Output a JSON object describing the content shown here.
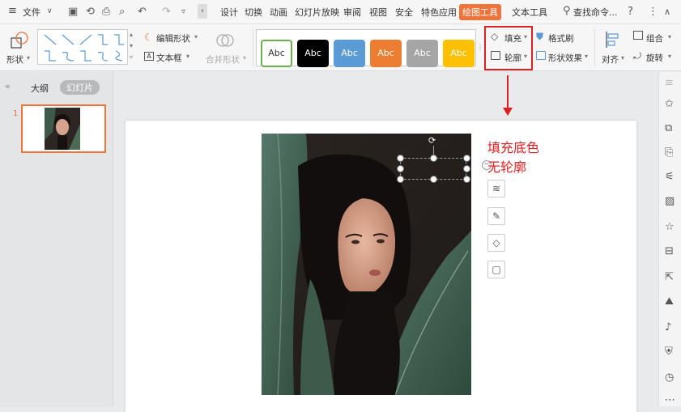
{
  "menubar": {
    "file_label": "文件",
    "tabs": [
      "设计",
      "切换",
      "动画",
      "幻灯片放映",
      "审阅",
      "视图",
      "安全",
      "特色应用",
      "绘图工具",
      "文本工具"
    ],
    "active_tab": "绘图工具",
    "search_label": "查找命令...",
    "accent_color": "#f0733a"
  },
  "ribbon": {
    "shape_label": "形状",
    "edit_shape_label": "编辑形状",
    "textbox_label": "文本框",
    "merge_shape_label": "合并形状",
    "style_swatches": [
      {
        "label": "Abc",
        "bg": "#ffffff",
        "border": "#6ab04c",
        "fg": "#333333"
      },
      {
        "label": "Abc",
        "bg": "#000000",
        "border": "#000000",
        "fg": "#ffffff"
      },
      {
        "label": "Abc",
        "bg": "#5b9bd5",
        "border": "#5b9bd5",
        "fg": "#ffffff"
      },
      {
        "label": "Abc",
        "bg": "#ed7d31",
        "border": "#ed7d31",
        "fg": "#ffffff"
      },
      {
        "label": "Abc",
        "bg": "#a5a5a5",
        "border": "#a5a5a5",
        "fg": "#ffffff"
      },
      {
        "label": "Abc",
        "bg": "#ffc000",
        "border": "#ffc000",
        "fg": "#ffffff"
      }
    ],
    "fill_label": "填充",
    "outline_label": "轮廓",
    "format_painter_label": "格式刷",
    "shape_effects_label": "形状效果",
    "align_label": "对齐",
    "group_label": "组合",
    "rotate_label": "旋转",
    "highlight_color": "#e02020"
  },
  "panel": {
    "outline_tab": "大纲",
    "slides_tab": "幻灯片",
    "slide_number": "1"
  },
  "annotation": {
    "line1": "填充底色",
    "line2": "无轮廓",
    "color": "#e02020"
  }
}
